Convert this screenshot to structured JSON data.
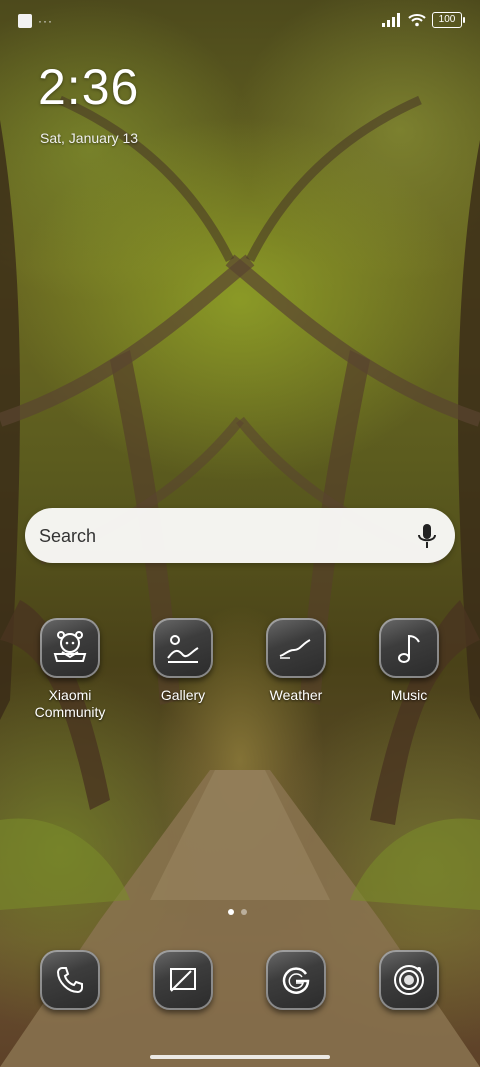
{
  "status_bar": {
    "notification_dots": "···",
    "battery": "100"
  },
  "clock": {
    "time": "2:36",
    "date": "Sat, January 13"
  },
  "search": {
    "placeholder": "Search"
  },
  "apps": [
    {
      "label": "Xiaomi Community",
      "icon": "xiaomi-community-icon"
    },
    {
      "label": "Gallery",
      "icon": "gallery-icon"
    },
    {
      "label": "Weather",
      "icon": "weather-icon"
    },
    {
      "label": "Music",
      "icon": "music-icon"
    }
  ],
  "dock": [
    {
      "icon": "phone-icon"
    },
    {
      "icon": "messages-icon"
    },
    {
      "icon": "google-icon"
    },
    {
      "icon": "camera-icon"
    }
  ],
  "pages": {
    "total": 2,
    "current": 1
  }
}
